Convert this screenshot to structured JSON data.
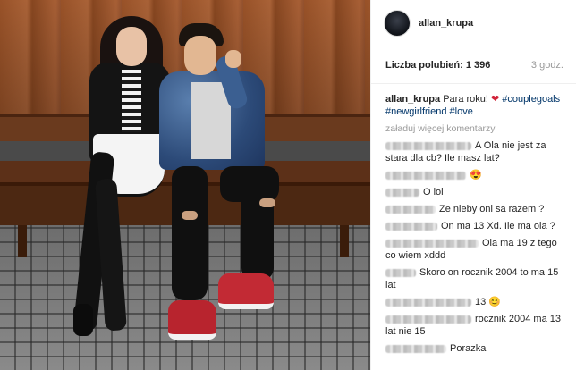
{
  "post": {
    "username": "allan_krupa",
    "likes_label": "Liczba polubień: 1 396",
    "time_ago": "3 godz."
  },
  "caption": {
    "author": "allan_krupa",
    "text": "Para roku!",
    "heart": "❤",
    "tags": [
      "#couplegoals",
      "#newgirlfriend",
      "#love"
    ]
  },
  "load_more": "załaduj więcej komentarzy",
  "comments": [
    {
      "text": "A Ola nie jest za stara dla cb? Ile masz lat?"
    },
    {
      "text": "",
      "emoji": "😍"
    },
    {
      "text": "O lol"
    },
    {
      "text": "Ze nieby oni sa razem ?"
    },
    {
      "text": "On ma 13 Xd. Ile ma ola ?"
    },
    {
      "text": "Ola ma 19 z tego co wiem xddd"
    },
    {
      "text": "Skoro on rocznik 2004 to ma 15 lat"
    },
    {
      "text": "13",
      "emoji": "😊"
    },
    {
      "text": "rocznik 2004 ma 13 lat nie 15"
    },
    {
      "text": "Porazka"
    }
  ],
  "icons": {
    "avatar": "avatar-image",
    "photo": "post-photo"
  },
  "colors": {
    "tag": "#003569",
    "heart": "#d1243a",
    "muted": "#999999"
  }
}
